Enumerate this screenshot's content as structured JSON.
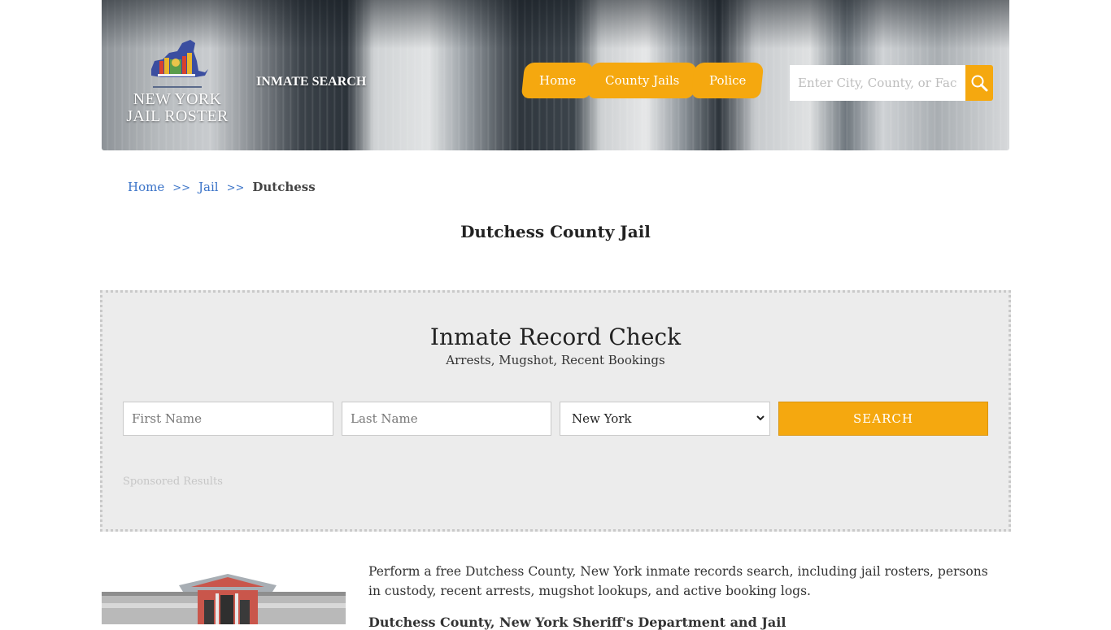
{
  "header": {
    "logo": {
      "line1": "NEW YORK",
      "line2": "JAIL ROSTER",
      "icon": "new-york-state-map-icon"
    },
    "inmate_search_label": "INMATE SEARCH",
    "nav": [
      {
        "label": "Home"
      },
      {
        "label": "County Jails"
      },
      {
        "label": "Police"
      }
    ],
    "search": {
      "placeholder": "Enter City, County, or Facility",
      "value": "",
      "icon": "magnifier-icon"
    }
  },
  "breadcrumb": {
    "items": [
      {
        "label": "Home"
      },
      {
        "label": "Jail"
      }
    ],
    "separator": ">>",
    "current": "Dutchess"
  },
  "page": {
    "title": "Dutchess County Jail"
  },
  "record_check": {
    "title": "Inmate Record Check",
    "subtitle": "Arrests, Mugshot, Recent Bookings",
    "first_name_placeholder": "First Name",
    "last_name_placeholder": "Last Name",
    "state_selected": "New York",
    "search_label": "SEARCH",
    "sponsored_label": "Sponsored Results"
  },
  "content": {
    "intro": "Perform a free Dutchess County, New York inmate records search, including jail rosters, persons in custody, recent arrests, mugshot lookups, and active booking logs.",
    "subheading": "Dutchess County, New York Sheriff's Department and Jail"
  },
  "colors": {
    "accent": "#f5a80f",
    "link": "#3a73c8",
    "panel": "#ececec"
  }
}
